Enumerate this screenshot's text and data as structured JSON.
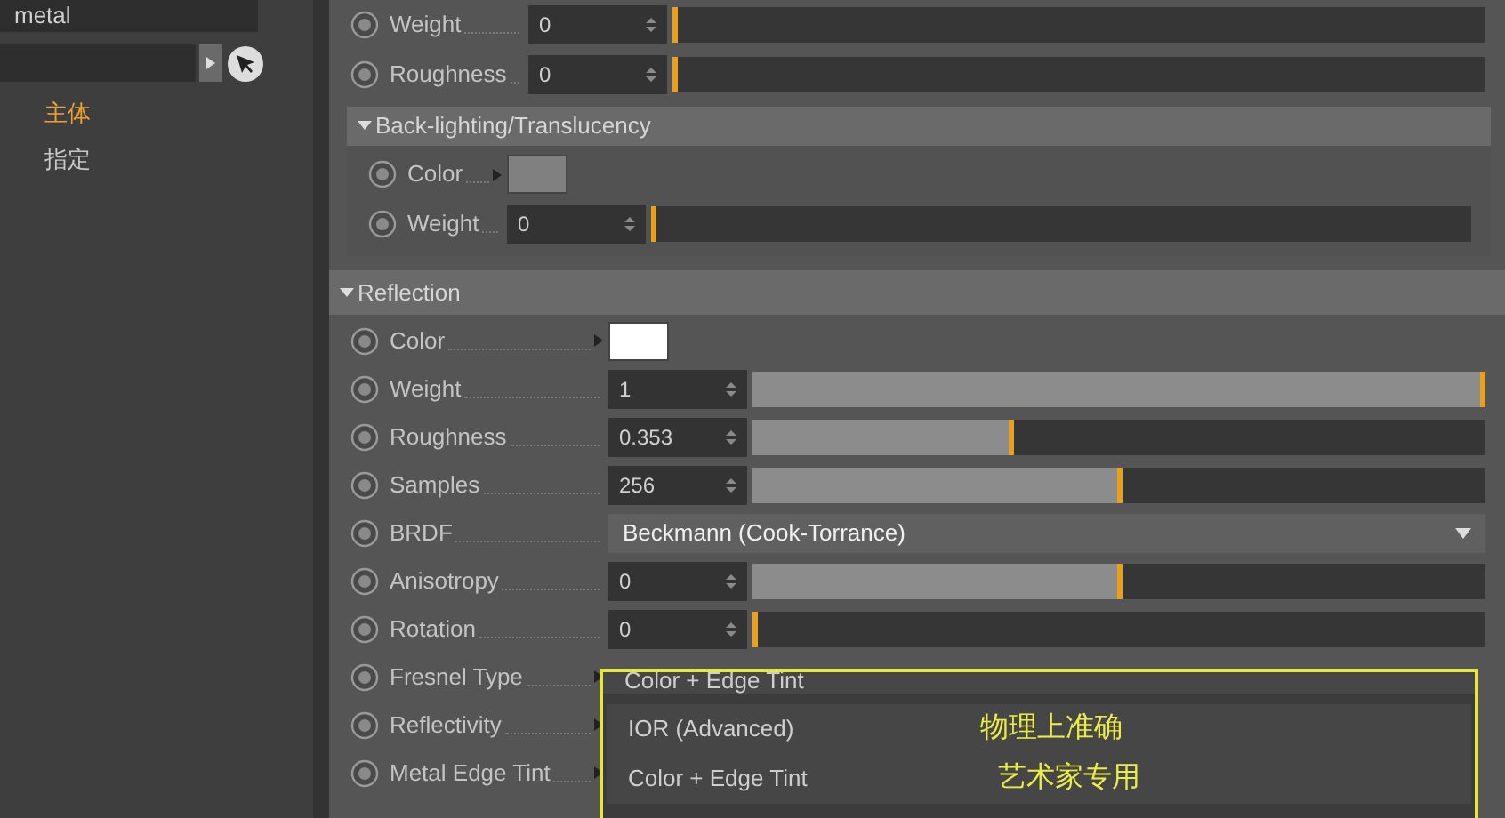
{
  "sidebar": {
    "name_field": {
      "value": "metal"
    },
    "items": [
      {
        "label": "主体",
        "selected": true
      },
      {
        "label": "指定",
        "selected": false
      }
    ]
  },
  "top_rows": [
    {
      "kind": "slider",
      "label": "Weight",
      "value": "0",
      "level": 0
    },
    {
      "kind": "slider",
      "label": "Roughness",
      "value": "0",
      "level": 0
    }
  ],
  "backlighting": {
    "title": "Back-lighting/Translucency",
    "expanded": true,
    "rows": [
      {
        "kind": "color",
        "label": "Color",
        "color": "#808080"
      },
      {
        "kind": "slider",
        "label": "Weight",
        "value": "0",
        "level": 0
      }
    ]
  },
  "reflection": {
    "title": "Reflection",
    "expanded": true,
    "rows": [
      {
        "kind": "color",
        "label": "Color",
        "color": "#ffffff"
      },
      {
        "kind": "slider",
        "label": "Weight",
        "value": "1",
        "level": 1
      },
      {
        "kind": "slider",
        "label": "Roughness",
        "value": "0.353",
        "level": 0.353
      },
      {
        "kind": "slider",
        "label": "Samples",
        "value": "256",
        "level": 0.5
      },
      {
        "kind": "dropdown",
        "label": "BRDF",
        "value": "Beckmann (Cook-Torrance)"
      },
      {
        "kind": "slider",
        "label": "Anisotropy",
        "value": "0",
        "level": 0.5
      },
      {
        "kind": "slider",
        "label": "Rotation",
        "value": "0",
        "level": 0
      },
      {
        "kind": "covered",
        "label": "Fresnel Type"
      },
      {
        "kind": "covered",
        "label": "Reflectivity"
      },
      {
        "kind": "covered",
        "label": "Metal Edge Tint"
      }
    ]
  },
  "dropdown_popup": {
    "current": "Color + Edge Tint",
    "options": [
      {
        "label": "IOR (Advanced)",
        "note": "物理上准确"
      },
      {
        "label": "Color + Edge Tint",
        "note": "艺术家专用"
      }
    ]
  }
}
